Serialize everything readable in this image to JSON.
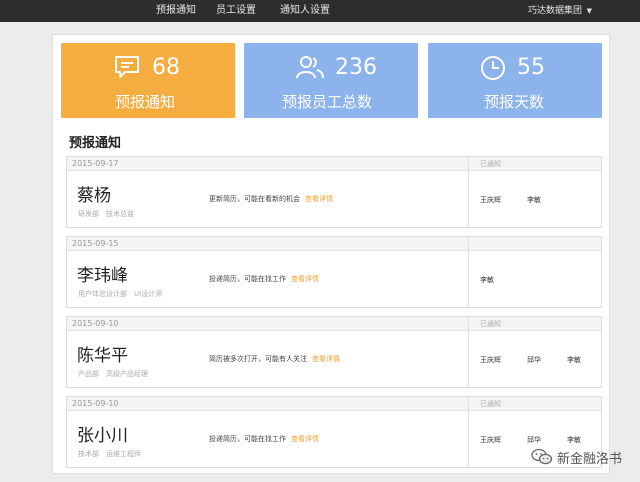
{
  "nav": {
    "items": [
      "预报通知",
      "员工设置",
      "通知人设置"
    ],
    "org": "巧达数据集团"
  },
  "stats": [
    {
      "icon": "chat-icon",
      "value": "68",
      "label": "预报通知",
      "color": "#f5ad3f"
    },
    {
      "icon": "users-icon",
      "value": "236",
      "label": "预报员工总数",
      "color": "#8db3ec"
    },
    {
      "icon": "clock-icon",
      "value": "55",
      "label": "预报天数",
      "color": "#8db3ec"
    }
  ],
  "section_title": "预报通知",
  "link_label": "查看详情",
  "notices": [
    {
      "date": "2015-09-17",
      "notified": "已通知",
      "name": "蔡杨",
      "dept": "研发部　技术总监",
      "status": "更新简历，可能在看新的机会",
      "people": [
        "王庆辉",
        "李敏"
      ]
    },
    {
      "date": "2015-09-15",
      "notified": "",
      "name": "李玮峰",
      "dept": "用户体验设计部　UI设计师",
      "status": "投递简历，可能在找工作",
      "people": [
        "李敏"
      ]
    },
    {
      "date": "2015-09-10",
      "notified": "已通知",
      "name": "陈华平",
      "dept": "产品部　高级产品经理",
      "status": "简历被多次打开，可能有人关注",
      "people": [
        "王庆辉",
        "邱华",
        "李敏"
      ]
    },
    {
      "date": "2015-09-10",
      "notified": "已通知",
      "name": "张小川",
      "dept": "技术部　运维工程师",
      "status": "投递简历，可能在找工作",
      "people": [
        "王庆辉",
        "邱华",
        "李敏"
      ]
    }
  ],
  "watermark": "新金融洛书"
}
